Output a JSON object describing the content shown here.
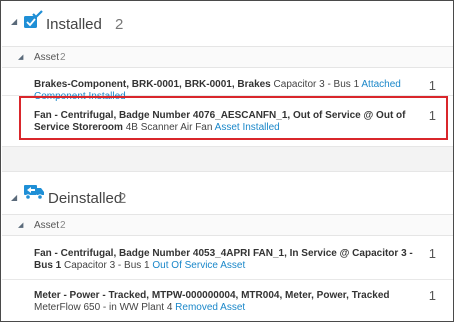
{
  "installed": {
    "title": "Installed",
    "count": "2",
    "icon": "installed-asset-icon",
    "group": {
      "label": "Asset",
      "count": "2"
    },
    "items": [
      {
        "name": "Brakes-Component, BRK-0001, BRK-0001, Brakes",
        "detail": "Capacitor 3 - Bus 1",
        "status": "Attached Component Installed",
        "qty": "1"
      },
      {
        "name": "Fan - Centrifugal, Badge Number 4076_AESCANFN_1, Out of Service @ Out of Service Storeroom",
        "detail": "4B Scanner Air Fan",
        "status": "Asset Installed",
        "qty": "1"
      }
    ]
  },
  "deinstalled": {
    "title": "Deinstalled",
    "count": "2",
    "icon": "truck-icon",
    "group": {
      "label": "Asset",
      "count": "2"
    },
    "items": [
      {
        "name": "Fan - Centrifugal, Badge Number 4053_4APRI FAN_1, In Service @ Capacitor 3 - Bus 1",
        "detail": "Capacitor 3 - Bus 1",
        "status": "Out Of Service Asset",
        "qty": "1"
      },
      {
        "name": "Meter - Power - Tracked, MTPW-000000004, MTR004, Meter, Power, Tracked",
        "detail": "MeterFlow 650 - in WW Plant 4",
        "status": "Removed Asset",
        "qty": "1"
      }
    ]
  },
  "colors": {
    "accent": "#1a87c9",
    "highlight": "#d9262b",
    "icon": "#1f8fd6"
  }
}
